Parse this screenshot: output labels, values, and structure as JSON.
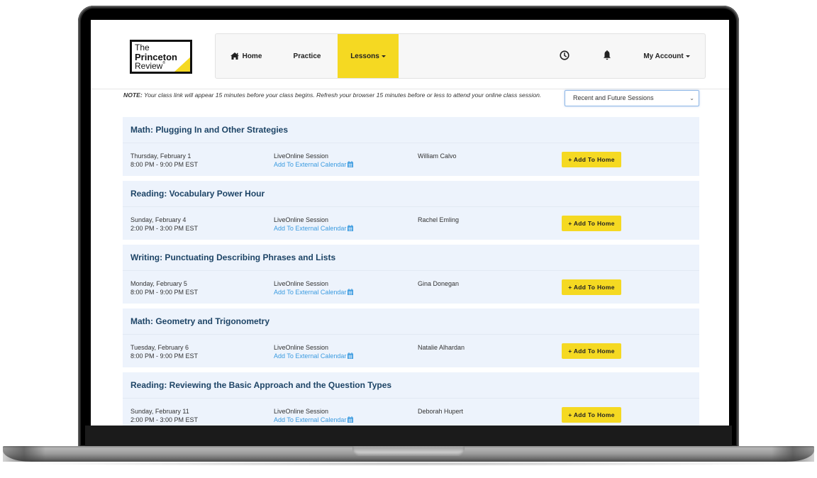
{
  "brand": {
    "logo_line1": "The",
    "logo_line2": "Princeton",
    "logo_line3": "Review",
    "logo_tm": "®",
    "accent_color": "#f5d922",
    "title_color": "#1d4466",
    "link_color": "#3b9be0"
  },
  "nav": {
    "home": "Home",
    "practice": "Practice",
    "lessons": "Lessons",
    "account": "My Account",
    "home_icon": "home-icon",
    "clock_icon": "clock-icon",
    "bell_icon": "bell-icon"
  },
  "note": {
    "label": "NOTE:",
    "text": " Your class link will appear 15 minutes before your class begins. Refresh your browser 15 minutes before or less to attend your online class session."
  },
  "filter": {
    "selected": "Recent and Future Sessions"
  },
  "sessions": [
    {
      "title": "Math: Plugging In and Other Strategies",
      "date": "Thursday, February 1",
      "time": "8:00 PM - 9:00 PM EST",
      "type": "LiveOnline Session",
      "calendar_link": "Add To External Calendar",
      "instructor": "William Calvo",
      "button": "+ Add To Home"
    },
    {
      "title": "Reading: Vocabulary Power Hour",
      "date": "Sunday, February 4",
      "time": "2:00 PM - 3:00 PM EST",
      "type": "LiveOnline Session",
      "calendar_link": "Add To External Calendar",
      "instructor": "Rachel Emling",
      "button": "+ Add To Home"
    },
    {
      "title": "Writing: Punctuating Describing Phrases and Lists",
      "date": "Monday, February 5",
      "time": "8:00 PM - 9:00 PM EST",
      "type": "LiveOnline Session",
      "calendar_link": "Add To External Calendar",
      "instructor": "Gina Donegan",
      "button": "+ Add To Home"
    },
    {
      "title": "Math: Geometry and Trigonometry",
      "date": "Tuesday, February 6",
      "time": "8:00 PM - 9:00 PM EST",
      "type": "LiveOnline Session",
      "calendar_link": "Add To External Calendar",
      "instructor": "Natalie Alhardan",
      "button": "+ Add To Home"
    },
    {
      "title": "Reading: Reviewing the Basic Approach and the Question Types",
      "date": "Sunday, February 11",
      "time": "2:00 PM - 3:00 PM EST",
      "type": "LiveOnline Session",
      "calendar_link": "Add To External Calendar",
      "instructor": "Deborah Hupert",
      "button": "+ Add To Home"
    }
  ]
}
